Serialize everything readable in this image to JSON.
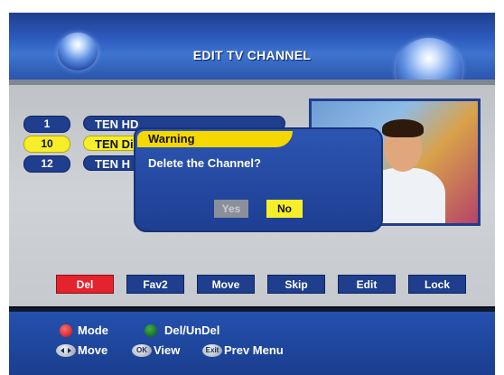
{
  "header": {
    "title": "EDIT TV CHANNEL"
  },
  "channels": [
    {
      "number": "1",
      "name": "TEN HD",
      "selected": false
    },
    {
      "number": "10",
      "name": "TEN Di",
      "selected": true
    },
    {
      "number": "12",
      "name": "TEN H",
      "selected": false
    }
  ],
  "dialog": {
    "title": "Warning",
    "message": "Delete the Channel?",
    "yes_label": "Yes",
    "no_label": "No"
  },
  "function_buttons": [
    {
      "label": "Del",
      "active": true
    },
    {
      "label": "Fav2",
      "active": false
    },
    {
      "label": "Move",
      "active": false
    },
    {
      "label": "Skip",
      "active": false
    },
    {
      "label": "Edit",
      "active": false
    },
    {
      "label": "Lock",
      "active": false
    }
  ],
  "footer": {
    "red_label": "Mode",
    "green_label": "Del/UnDel",
    "move_label": "Move",
    "ok_key": "OK",
    "view_label": "View",
    "exit_key": "Exit",
    "prev_menu_label": "Prev Menu"
  },
  "colors": {
    "panel_blue": "#1f3e8e",
    "highlight_yellow": "#f6ee2a",
    "active_red": "#e5232e"
  },
  "icons": [
    "red-button-icon",
    "green-button-icon",
    "navigation-arrows-icon",
    "ok-button-icon",
    "exit-button-icon"
  ]
}
